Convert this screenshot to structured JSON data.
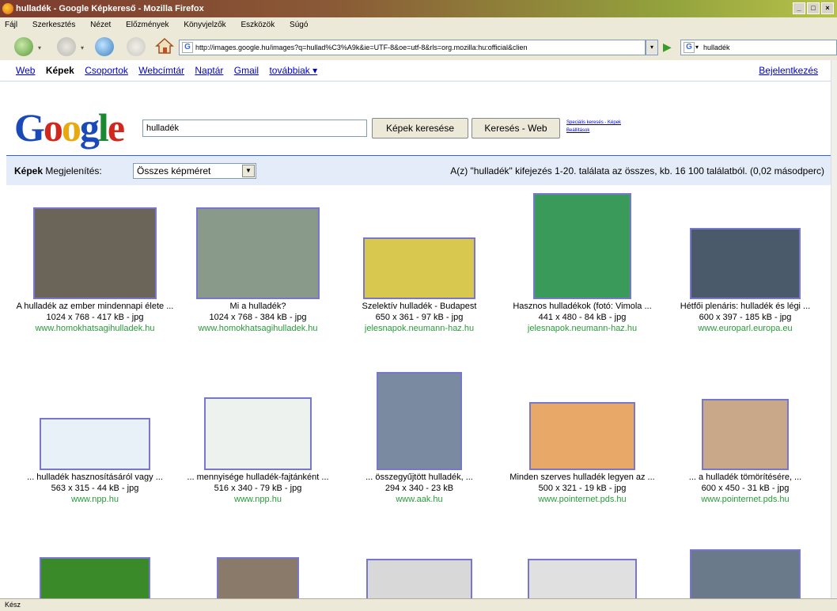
{
  "window": {
    "title": "hulladék - Google Képkereső - Mozilla Firefox",
    "buttons": [
      "_",
      "□",
      "×"
    ]
  },
  "menu": [
    "Fájl",
    "Szerkesztés",
    "Nézet",
    "Előzmények",
    "Könyvjelzők",
    "Eszközök",
    "Súgó"
  ],
  "url": "http://images.google.hu/images?q=hullad%C3%A9k&ie=UTF-8&oe=utf-8&rls=org.mozilla:hu:official&clien",
  "search_engine_query": "hulladék",
  "gbar": {
    "web": "Web",
    "images": "Képek",
    "groups": "Csoportok",
    "directory": "Webcímtár",
    "calendar": "Naptár",
    "gmail": "Gmail",
    "more": "továbbiak ▾",
    "login": "Bejelentkezés"
  },
  "search": {
    "query": "hulladék",
    "btn_images": "Képek keresése",
    "btn_web": "Keresés - Web",
    "advanced": "Speciális keresés - Képek",
    "prefs": "Beállítások"
  },
  "bar": {
    "label_images": "Képek",
    "label_display": "Megjelenítés:",
    "select_value": "Összes képméret",
    "stats": "A(z) \"hulladék\" kifejezés 1-20. találata az összes, kb. 16 100 találatból. (0,02 másodperc)"
  },
  "results": [
    {
      "caption": "A hulladék az ember mindennapi élete ...",
      "meta": "1024 x 768 - 417 kB - jpg",
      "site": "www.homokhatsagihulladek.hu",
      "color": "#6b6458"
    },
    {
      "caption": "Mi a hulladék?",
      "meta": "1024 x 768 - 384 kB - jpg",
      "site": "www.homokhatsagihulladek.hu",
      "color": "#8a9a8a"
    },
    {
      "caption": "Szelektív hulladék - Budapest",
      "meta": "650 x 361 - 97 kB - jpg",
      "site": "jelesnapok.neumann-haz.hu",
      "color": "#d8c850"
    },
    {
      "caption": "Hasznos hulladékok (fotó: Vimola ...",
      "meta": "441 x 480 - 84 kB - jpg",
      "site": "jelesnapok.neumann-haz.hu",
      "color": "#3a9a5a"
    },
    {
      "caption": "Hétfői plenáris: hulladék és légi ...",
      "meta": "600 x 397 - 185 kB - jpg",
      "site": "www.europarl.europa.eu",
      "color": "#4a5a6a"
    },
    {
      "caption": "... hulladék hasznosításáról vagy ...",
      "meta": "563 x 315 - 44 kB - jpg",
      "site": "www.npp.hu",
      "color": "#e8f0f8"
    },
    {
      "caption": "... mennyisége hulladék-fajtánként ...",
      "meta": "516 x 340 - 79 kB - jpg",
      "site": "www.npp.hu",
      "color": "#eef2ee"
    },
    {
      "caption": "... összegyűjtött hulladék, ...",
      "meta": "294 x 340 - 23 kB",
      "site": "www.aak.hu",
      "color": "#7a8aa0"
    },
    {
      "caption": "Minden szerves hulladék legyen az ...",
      "meta": "500 x 321 - 19 kB - jpg",
      "site": "www.pointernet.pds.hu",
      "color": "#e8a868"
    },
    {
      "caption": "... a hulladék tömörítésére, ...",
      "meta": "600 x 450 - 31 kB - jpg",
      "site": "www.pointernet.pds.hu",
      "color": "#c8a888"
    },
    {
      "caption": "",
      "meta": "",
      "site": "",
      "color": "#3a8a2a"
    },
    {
      "caption": "",
      "meta": "",
      "site": "",
      "color": "#8a7a6a"
    },
    {
      "caption": "",
      "meta": "",
      "site": "",
      "color": "#d8d8d8"
    },
    {
      "caption": "",
      "meta": "",
      "site": "",
      "color": "#e0e0e0"
    },
    {
      "caption": "",
      "meta": "",
      "site": "",
      "color": "#6a7a8a"
    }
  ],
  "status": "Kész"
}
